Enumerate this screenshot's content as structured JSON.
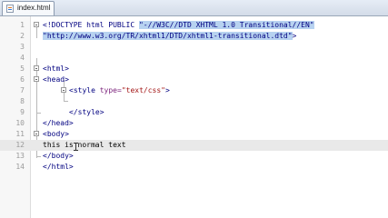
{
  "tabs": [
    {
      "label": "index.html",
      "active": true
    }
  ],
  "editor": {
    "lines": [
      {
        "num": "1",
        "parts": {
          "a": "<!DOCTYPE html PUBLIC ",
          "b": "\"-//W3C//DTD XHTML 1.0 Transitional//EN\""
        }
      },
      {
        "num": "2",
        "parts": {
          "a": "\"http://www.w3.org/TR/xhtml1/DTD/xhtml1-transitional.dtd\"",
          "b": ">"
        }
      },
      {
        "num": "3",
        "text": ""
      },
      {
        "num": "4",
        "text": ""
      },
      {
        "num": "5",
        "text": "<html>"
      },
      {
        "num": "6",
        "text": "<head>"
      },
      {
        "num": "7",
        "parts": {
          "a": "<style ",
          "b": "type=",
          "c": "\"text/css\"",
          "d": ">"
        }
      },
      {
        "num": "8",
        "text": ""
      },
      {
        "num": "9",
        "text": "</style>"
      },
      {
        "num": "10",
        "text": "</head>"
      },
      {
        "num": "11",
        "text": "<body>"
      },
      {
        "num": "12",
        "text": "this is normal text"
      },
      {
        "num": "13",
        "text": "</body>"
      },
      {
        "num": "14",
        "text": "</html>"
      }
    ]
  },
  "colors": {
    "tag": "#000080",
    "attribute": "#7a1f7a",
    "value": "#a31515",
    "selection": "#b7d2f0",
    "current_line": "#e9e9e9"
  }
}
